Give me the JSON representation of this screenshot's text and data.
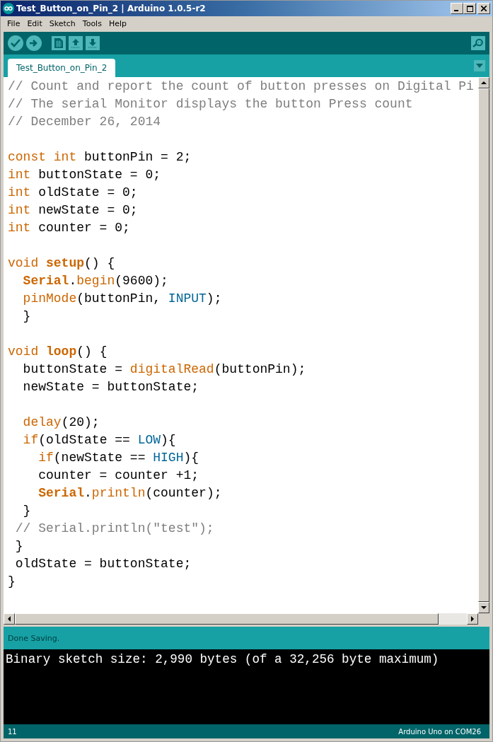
{
  "window": {
    "title": "Test_Button_on_Pin_2 | Arduino 1.0.5-r2"
  },
  "menu": [
    "File",
    "Edit",
    "Sketch",
    "Tools",
    "Help"
  ],
  "tabs": [
    {
      "label": "Test_Button_on_Pin_2",
      "selected": true
    }
  ],
  "code_blocks": [
    {
      "lines": [
        {
          "tokens": [
            {
              "kind": "comment",
              "text": "// Count and report the count of button presses on Digital Pi"
            }
          ]
        },
        {
          "tokens": [
            {
              "kind": "comment",
              "text": "// The serial Monitor displays the button Press count"
            }
          ]
        },
        {
          "tokens": [
            {
              "kind": "comment",
              "text": "// December 26, 2014"
            }
          ]
        }
      ]
    },
    {
      "lines": [
        {
          "tokens": [
            {
              "kind": "keyword",
              "text": "const"
            },
            {
              "kind": "keyword",
              "text": " int"
            },
            {
              "kind": "plain",
              "text": " buttonPin = 2;"
            }
          ]
        },
        {
          "tokens": [
            {
              "kind": "keyword",
              "text": "int"
            },
            {
              "kind": "plain",
              "text": " buttonState = 0;"
            }
          ]
        },
        {
          "tokens": [
            {
              "kind": "keyword",
              "text": "int"
            },
            {
              "kind": "plain",
              "text": " oldState = 0;"
            }
          ]
        },
        {
          "tokens": [
            {
              "kind": "keyword",
              "text": "int"
            },
            {
              "kind": "plain",
              "text": " newState = 0;"
            }
          ]
        },
        {
          "tokens": [
            {
              "kind": "keyword",
              "text": "int"
            },
            {
              "kind": "plain",
              "text": " counter = 0;"
            }
          ]
        }
      ]
    },
    {
      "lines": [
        {
          "tokens": [
            {
              "kind": "keyword",
              "text": "void"
            },
            {
              "kind": "bold",
              "text": " setup"
            },
            {
              "kind": "plain",
              "text": "() {"
            }
          ]
        },
        {
          "tokens": [
            {
              "kind": "bold",
              "text": "  Serial"
            },
            {
              "kind": "plain",
              "text": "."
            },
            {
              "kind": "keyword",
              "text": "begin"
            },
            {
              "kind": "plain",
              "text": "(9600);"
            }
          ]
        },
        {
          "tokens": [
            {
              "kind": "keyword",
              "text": "  pinMode"
            },
            {
              "kind": "plain",
              "text": "(buttonPin, "
            },
            {
              "kind": "constant",
              "text": "INPUT"
            },
            {
              "kind": "plain",
              "text": ");"
            }
          ]
        },
        {
          "tokens": [
            {
              "kind": "plain",
              "text": "  }"
            }
          ]
        }
      ]
    },
    {
      "lines": [
        {
          "tokens": [
            {
              "kind": "keyword",
              "text": "void"
            },
            {
              "kind": "bold",
              "text": " loop"
            },
            {
              "kind": "plain",
              "text": "() {"
            }
          ]
        },
        {
          "tokens": [
            {
              "kind": "plain",
              "text": "  buttonState = "
            },
            {
              "kind": "keyword",
              "text": "digitalRead"
            },
            {
              "kind": "plain",
              "text": "(buttonPin);"
            }
          ]
        },
        {
          "tokens": [
            {
              "kind": "plain",
              "text": "  newState = buttonState;"
            }
          ]
        }
      ]
    },
    {
      "lines": [
        {
          "tokens": [
            {
              "kind": "keyword",
              "text": "  delay"
            },
            {
              "kind": "plain",
              "text": "(20);"
            }
          ]
        },
        {
          "tokens": [
            {
              "kind": "keyword",
              "text": "  if"
            },
            {
              "kind": "plain",
              "text": "(oldState == "
            },
            {
              "kind": "constant",
              "text": "LOW"
            },
            {
              "kind": "plain",
              "text": "){"
            }
          ]
        },
        {
          "tokens": [
            {
              "kind": "keyword",
              "text": "    if"
            },
            {
              "kind": "plain",
              "text": "(newState == "
            },
            {
              "kind": "constant",
              "text": "HIGH"
            },
            {
              "kind": "plain",
              "text": "){"
            }
          ]
        },
        {
          "tokens": [
            {
              "kind": "plain",
              "text": "    counter = counter +1;"
            }
          ]
        },
        {
          "tokens": [
            {
              "kind": "bold",
              "text": "    Serial"
            },
            {
              "kind": "plain",
              "text": "."
            },
            {
              "kind": "keyword",
              "text": "println"
            },
            {
              "kind": "plain",
              "text": "(counter);"
            }
          ]
        },
        {
          "tokens": [
            {
              "kind": "plain",
              "text": "  }"
            }
          ]
        },
        {
          "tokens": [
            {
              "kind": "comment",
              "text": " // Serial.println(\"test\");"
            }
          ]
        },
        {
          "tokens": [
            {
              "kind": "plain",
              "text": " }"
            }
          ]
        },
        {
          "tokens": [
            {
              "kind": "plain",
              "text": " oldState = buttonState;"
            }
          ]
        },
        {
          "tokens": [
            {
              "kind": "plain",
              "text": "}"
            }
          ]
        }
      ]
    }
  ],
  "status": "Done Saving.",
  "console": "Binary sketch size: 2,990 bytes (of a 32,256 byte maximum)",
  "footer": {
    "line": "11",
    "board": "Arduino Uno on COM26"
  }
}
